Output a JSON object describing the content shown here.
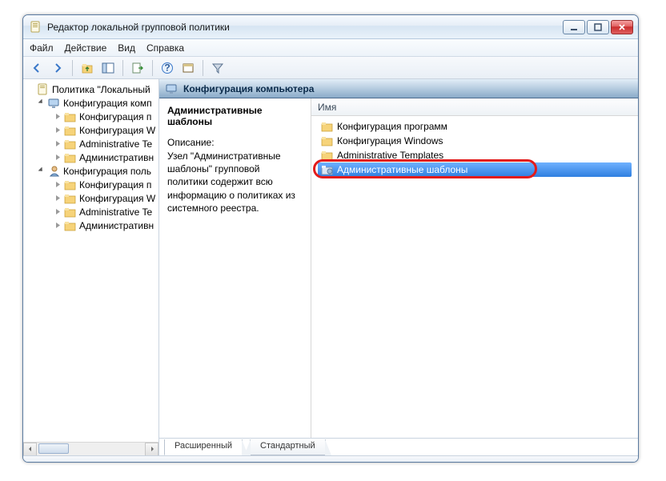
{
  "window": {
    "title": "Редактор локальной групповой политики"
  },
  "menu": {
    "file": "Файл",
    "action": "Действие",
    "view": "Вид",
    "help": "Справка"
  },
  "tree": {
    "root": "Политика \"Локальный",
    "comp_config": "Конфигурация комп",
    "comp_children": [
      "Конфигурация п",
      "Конфигурация W",
      "Administrative Te",
      "Административн"
    ],
    "user_config": "Конфигурация поль",
    "user_children": [
      "Конфигурация п",
      "Конфигурация W",
      "Administrative Te",
      "Административн"
    ]
  },
  "main": {
    "header": "Конфигурация компьютера",
    "detail_title": "Административные шаблоны",
    "desc_label": "Описание:",
    "desc_text": "Узел \"Административные шаблоны\" групповой политики содержит всю информацию о политиках из системного реестра.",
    "column_name": "Имя",
    "items": [
      "Конфигурация программ",
      "Конфигурация Windows",
      "Administrative Templates",
      "Административные шаблоны"
    ],
    "selected_index": 3
  },
  "tabs": {
    "extended": "Расширенный",
    "standard": "Стандартный"
  }
}
